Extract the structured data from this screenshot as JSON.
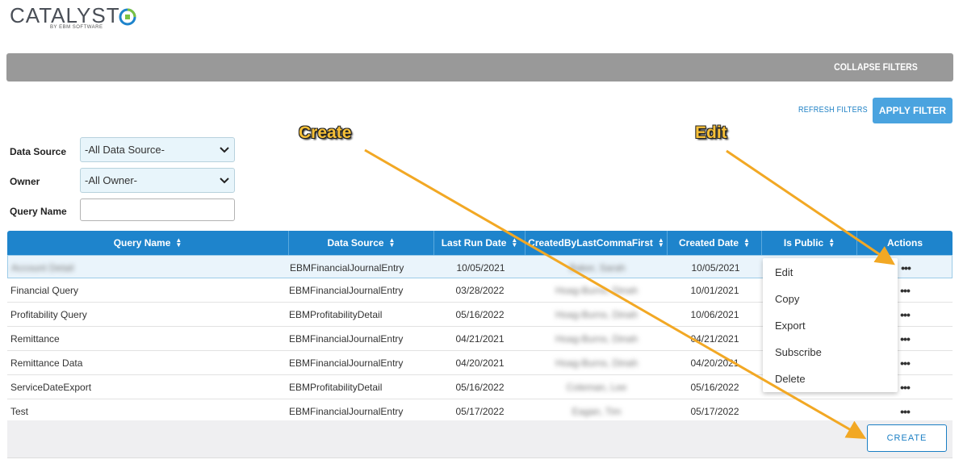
{
  "brand": {
    "name": "CATALYST",
    "tagline": "BY EBM SOFTWARE",
    "accent": "#1e84cc"
  },
  "filters": {
    "collapse_label": "COLLAPSE FILTERS",
    "refresh_label": "REFRESH FILTERS",
    "apply_label": "APPLY FILTER",
    "data_source": {
      "label": "Data Source",
      "value": "-All Data Source-"
    },
    "owner": {
      "label": "Owner",
      "value": "-All Owner-"
    },
    "query_name": {
      "label": "Query Name",
      "value": ""
    }
  },
  "table": {
    "columns": [
      "Query Name",
      "Data Source",
      "Last Run Date",
      "CreatedByLastCommaFirst",
      "Created Date",
      "Is Public",
      "Actions"
    ],
    "rows": [
      {
        "name": "Account Detail",
        "source": "EBMFinancialJournalEntry",
        "last_run": "10/05/2021",
        "created_by": "Baker, Sarah",
        "created": "10/05/2021",
        "actions": "•••"
      },
      {
        "name": "Financial Query",
        "source": "EBMFinancialJournalEntry",
        "last_run": "03/28/2022",
        "created_by": "Hoag-Burns, Dinah",
        "created": "10/01/2021",
        "actions": "•••"
      },
      {
        "name": "Profitability Query",
        "source": "EBMProfitabilityDetail",
        "last_run": "05/16/2022",
        "created_by": "Hoag-Burns, Dinah",
        "created": "10/06/2021",
        "actions": "•••"
      },
      {
        "name": "Remittance",
        "source": "EBMFinancialJournalEntry",
        "last_run": "04/21/2021",
        "created_by": "Hoag-Burns, Dinah",
        "created": "04/21/2021",
        "actions": "•••"
      },
      {
        "name": "Remittance Data",
        "source": "EBMFinancialJournalEntry",
        "last_run": "04/20/2021",
        "created_by": "Hoag-Burns, Dinah",
        "created": "04/20/2021",
        "actions": "•••"
      },
      {
        "name": "ServiceDateExport",
        "source": "EBMProfitabilityDetail",
        "last_run": "05/16/2022",
        "created_by": "Coleman, Lee",
        "created": "05/16/2022",
        "actions": "•••"
      },
      {
        "name": "Test",
        "source": "EBMFinancialJournalEntry",
        "last_run": "05/17/2022",
        "created_by": "Eagan, Tim",
        "created": "05/17/2022",
        "actions": "•••"
      }
    ]
  },
  "actions_menu": {
    "items": [
      "Edit",
      "Copy",
      "Export",
      "Subscribe",
      "Delete"
    ]
  },
  "create_label": "CREATE",
  "annotations": {
    "create": "Create",
    "edit": "Edit"
  }
}
